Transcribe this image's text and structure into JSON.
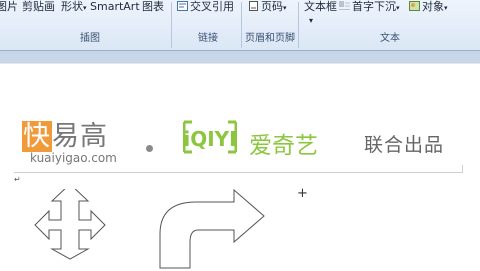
{
  "ribbon": {
    "items": {
      "picture": "图片",
      "clipart": "剪贴画",
      "shapes": "形状",
      "smartart": "SmartArt",
      "chart": "图表",
      "crossref": "交叉引用",
      "pagenum": "页码",
      "textbox": "文本框",
      "dropcap": "首字下沉",
      "object": "对象"
    },
    "groups": {
      "illustrations": "插图",
      "links": "链接",
      "header_footer": "页眉和页脚",
      "text": "文本"
    }
  },
  "document": {
    "logo_kuai_hl": "快",
    "logo_kuai_rest": "易高",
    "logo_url": "kuaiyigao.com",
    "iqiyi_mark": "iQIYI",
    "iqiyi_name": "爱奇艺",
    "joint": "联合出品",
    "para_mark": "↵",
    "cursor": "+"
  },
  "colors": {
    "orange": "#f19a3a",
    "green": "#8cc63f",
    "ribbon_bg": "#dbe7f5"
  }
}
